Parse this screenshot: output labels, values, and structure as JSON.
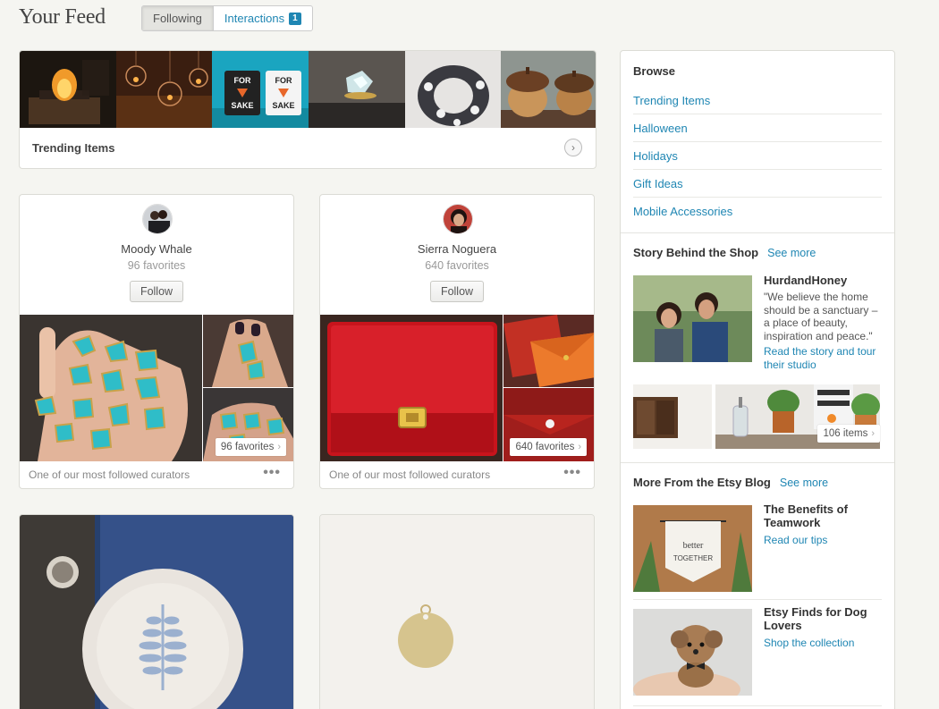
{
  "header": {
    "title": "Your Feed",
    "tabs": [
      {
        "label": "Following",
        "active": true
      },
      {
        "label": "Interactions",
        "badge": "1",
        "active": false
      }
    ]
  },
  "trending": {
    "label": "Trending Items",
    "thumbnails": [
      "fire-pit",
      "hanging-glass-terrariums",
      "for-sake-mugs",
      "raw-crystal-ring",
      "patterned-infinity-scarf",
      "wooden-acorn-boxes"
    ],
    "mug_text": "FOR SAKE"
  },
  "curators": [
    {
      "name": "Moody Whale",
      "favorites": "96 favorites",
      "follow_label": "Follow",
      "pill": "96 favorites",
      "footer": "One of our most followed curators",
      "more": "•••"
    },
    {
      "name": "Sierra Noguera",
      "favorites": "640 favorites",
      "follow_label": "Follow",
      "pill": "640 favorites",
      "footer": "One of our most followed curators",
      "more": "•••"
    }
  ],
  "sidebar": {
    "browse": {
      "heading": "Browse",
      "items": [
        "Trending Items",
        "Halloween",
        "Holidays",
        "Gift Ideas",
        "Mobile Accessories"
      ]
    },
    "story": {
      "heading": "Story Behind the Shop",
      "see_more": "See more",
      "shop_name": "HurdandHoney",
      "quote": "\"We believe the home should be a sanctuary – a place of beauty, inspiration and peace.\"",
      "link": "Read the story and tour their studio",
      "items_pill": "106 items"
    },
    "blog": {
      "heading": "More From the Etsy Blog",
      "see_more": "See more",
      "banner_text": "better TOGETHER",
      "posts": [
        {
          "title": "The Benefits of Teamwork",
          "link": "Read our tips"
        },
        {
          "title": "Etsy Finds for Dog Lovers",
          "link": "Shop the collection"
        }
      ]
    }
  },
  "colors": {
    "link": "#1f86b3",
    "background": "#f5f5f1",
    "red_wallet": "#c8141c"
  }
}
